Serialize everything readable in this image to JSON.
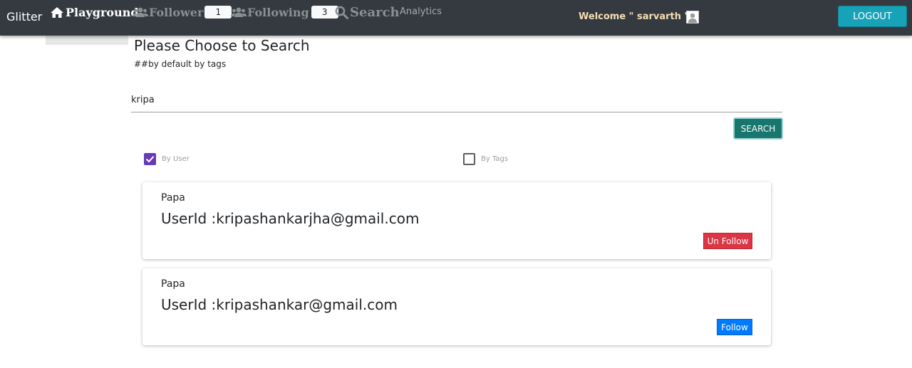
{
  "navbar": {
    "brand": "Glitter",
    "playground": {
      "label": "Playground",
      "icon": "home-icon"
    },
    "follower": {
      "label": "Follower",
      "count": "1",
      "icon": "users-icon"
    },
    "following": {
      "label": "Following",
      "count": "3",
      "icon": "users-icon"
    },
    "search": {
      "label": "Search",
      "icon": "search-icon"
    },
    "analytics": {
      "label": "Analytics"
    },
    "welcome": "Welcome \" sarvarth \"",
    "avatar_icon": "user-avatar-icon",
    "logout": "LOGOUT"
  },
  "main": {
    "title": "Please Choose to Search",
    "subtitle": "##by default by tags",
    "search_value": "kripa",
    "search_button": "SEARCH",
    "filters": [
      {
        "label": "By User",
        "checked": true
      },
      {
        "label": "By Tags",
        "checked": false
      }
    ]
  },
  "results": [
    {
      "name": "Papa",
      "userid": "UserId :kripashankarjha@gmail.com",
      "action": "Un Follow"
    },
    {
      "name": "Papa",
      "userid": "UserId :kripashankar@gmail.com",
      "action": "Follow"
    }
  ],
  "colors": {
    "navbar_bg": "#343a40",
    "logout_bg": "#17a2b8",
    "search_btn_bg": "#17766e",
    "checkbox_checked": "#673ab7",
    "unfollow_bg": "#dc3545",
    "follow_bg": "#007bff",
    "welcome_text": "#f5deb3"
  }
}
